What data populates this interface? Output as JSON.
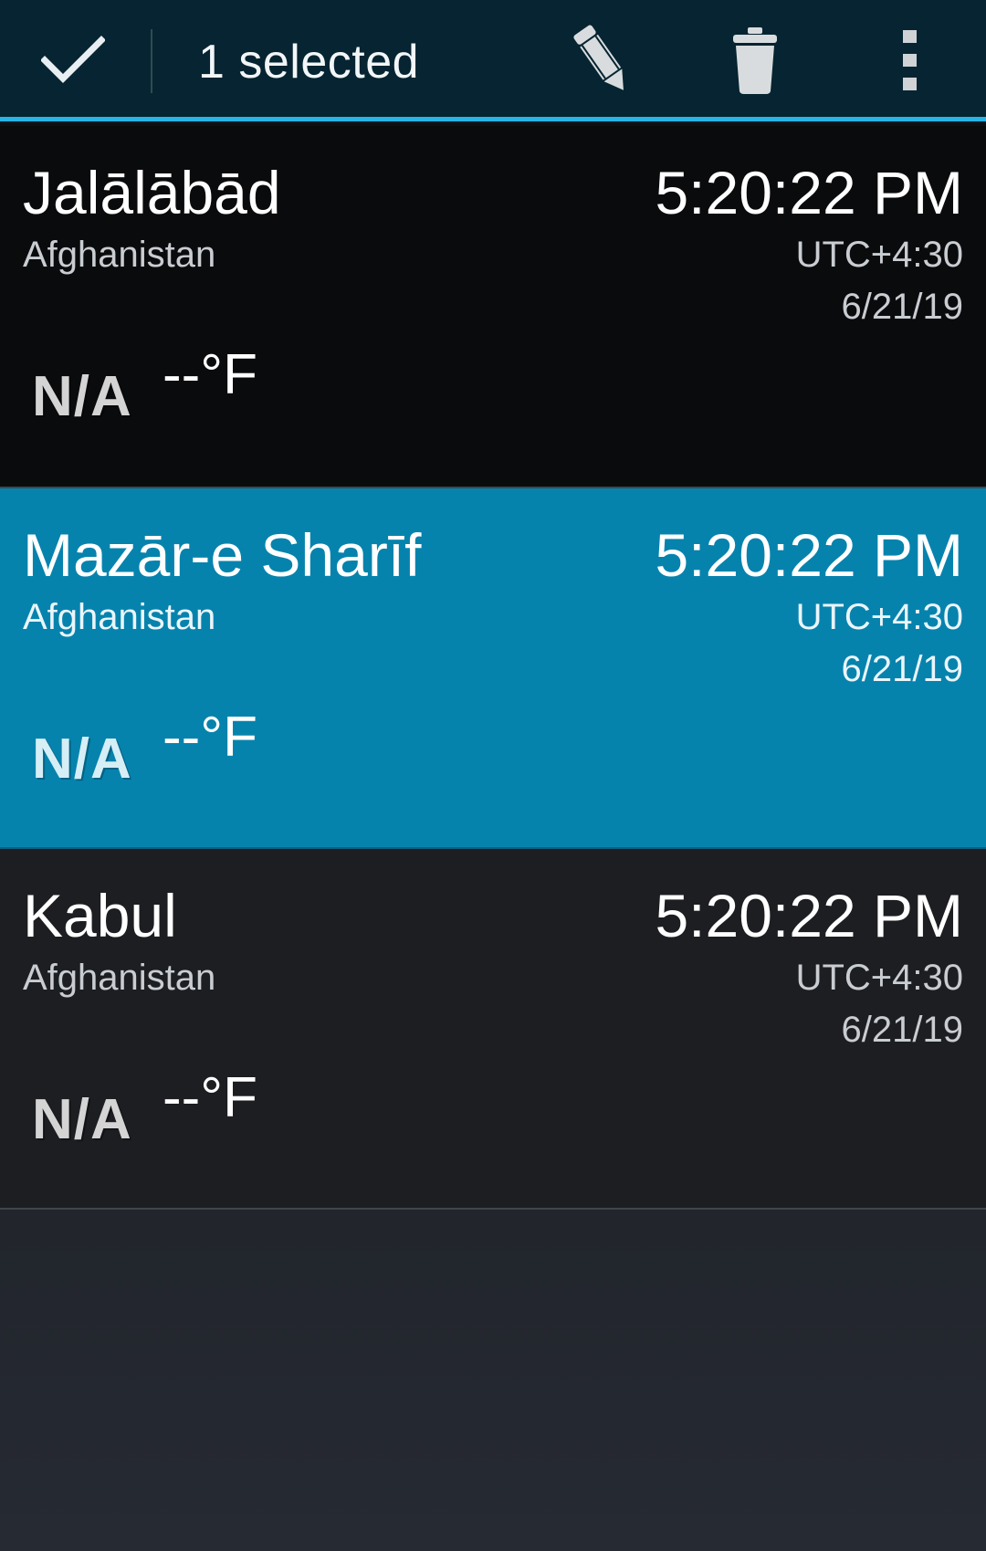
{
  "action_bar": {
    "selected_label": "1 selected",
    "done_icon": "checkmark-icon",
    "actions": [
      {
        "name": "edit",
        "icon": "pencil-icon"
      },
      {
        "name": "delete",
        "icon": "trash-icon"
      },
      {
        "name": "more",
        "icon": "overflow-menu-icon"
      }
    ],
    "background_color": "#062431",
    "accent_color": "#2ab3e6"
  },
  "cities": [
    {
      "name": "Jalālābād",
      "country": "Afghanistan",
      "time": "5:20:22 PM",
      "utc_offset": "UTC+4:30",
      "date": "6/21/19",
      "weather": "N/A",
      "temperature": "--°F",
      "selected": false
    },
    {
      "name": "Mazār-e Sharīf",
      "country": "Afghanistan",
      "time": "5:20:22 PM",
      "utc_offset": "UTC+4:30",
      "date": "6/21/19",
      "weather": "N/A",
      "temperature": "--°F",
      "selected": true
    },
    {
      "name": "Kabul",
      "country": "Afghanistan",
      "time": "5:20:22 PM",
      "utc_offset": "UTC+4:30",
      "date": "6/21/19",
      "weather": "N/A",
      "temperature": "--°F",
      "selected": false
    }
  ],
  "selection_color": "#0683ad"
}
